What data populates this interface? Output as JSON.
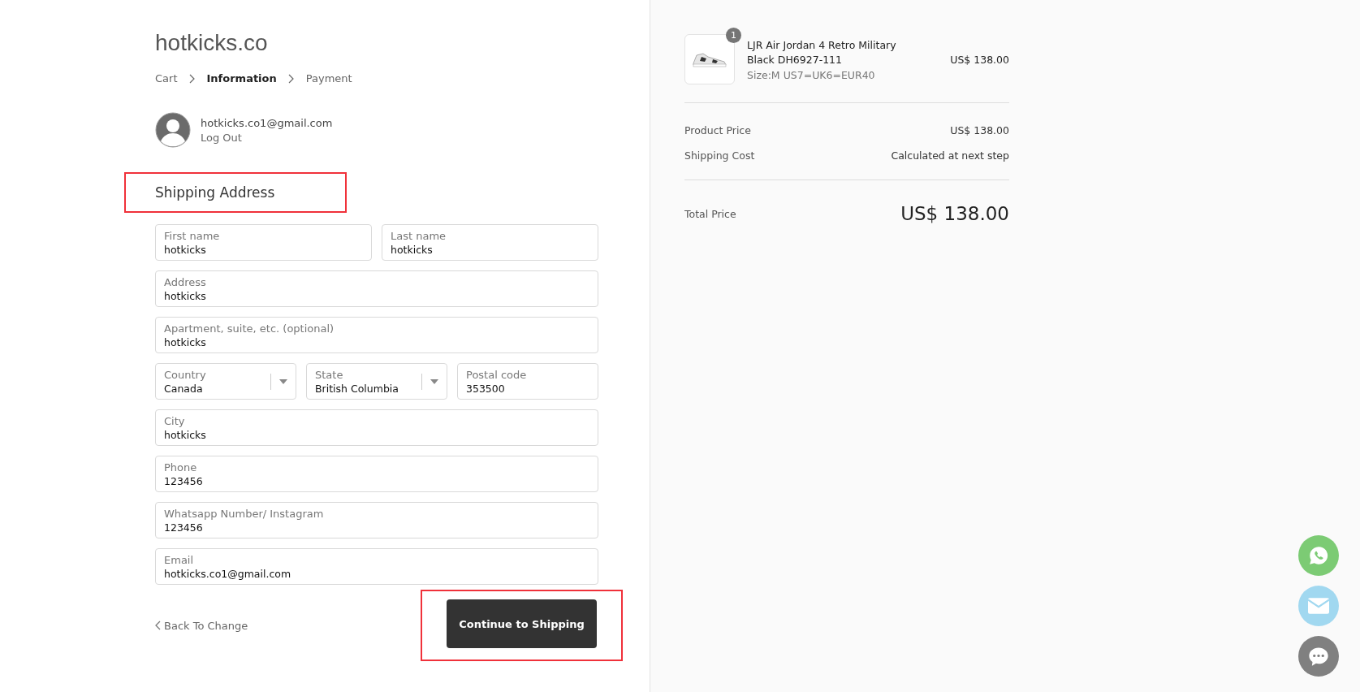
{
  "store": {
    "logo": "hotkicks.co"
  },
  "breadcrumb": [
    {
      "label": "Cart",
      "selected": false
    },
    {
      "label": "Information",
      "selected": true
    },
    {
      "label": "Payment",
      "selected": false
    }
  ],
  "account": {
    "email": "hotkicks.co1@gmail.com",
    "logout": "Log Out"
  },
  "form": {
    "title": "Shipping Address",
    "rows": [
      {
        "fields": [
          {
            "kind": "text",
            "label": "First name",
            "value": "hotkicks"
          },
          {
            "kind": "text",
            "label": "Last name",
            "value": "hotkicks"
          }
        ]
      },
      {
        "fields": [
          {
            "kind": "text",
            "label": "Address",
            "value": "hotkicks"
          }
        ]
      },
      {
        "fields": [
          {
            "kind": "text",
            "label": "Apartment, suite, etc. (optional)",
            "value": "hotkicks"
          }
        ]
      },
      {
        "fields": [
          {
            "kind": "select",
            "label": "Country",
            "value": "Canada"
          },
          {
            "kind": "select",
            "label": "State",
            "value": "British Columbia"
          },
          {
            "kind": "text",
            "label": "Postal code",
            "value": "353500"
          }
        ]
      },
      {
        "fields": [
          {
            "kind": "text",
            "label": "City",
            "value": "hotkicks"
          }
        ]
      },
      {
        "fields": [
          {
            "kind": "text",
            "label": "Phone",
            "value": "123456"
          }
        ]
      },
      {
        "fields": [
          {
            "kind": "text",
            "label": "Whatsapp Number/ Instagram",
            "value": "123456"
          }
        ]
      },
      {
        "fields": [
          {
            "kind": "text",
            "label": "Email",
            "value": "hotkicks.co1@gmail.com"
          }
        ]
      }
    ],
    "back": "Back To Change",
    "submit": "Continue to Shipping"
  },
  "summary": {
    "item": {
      "quantity": "1",
      "name": "LJR Air Jordan 4 Retro Military Black DH6927-111",
      "variant": "Size:M US7=UK6=EUR40",
      "price": "US$ 138.00"
    },
    "lines": [
      {
        "label": "Product Price",
        "value": "US$ 138.00"
      },
      {
        "label": "Shipping Cost",
        "value": "Calculated at next step"
      }
    ],
    "total": {
      "label": "Total Price",
      "value": "US$ 138.00"
    }
  },
  "contact_buttons": [
    {
      "kind": "whatsapp",
      "color": "#7ccb74"
    },
    {
      "kind": "email",
      "color": "#a1d8f0"
    },
    {
      "kind": "chat",
      "color": "#808080"
    }
  ]
}
